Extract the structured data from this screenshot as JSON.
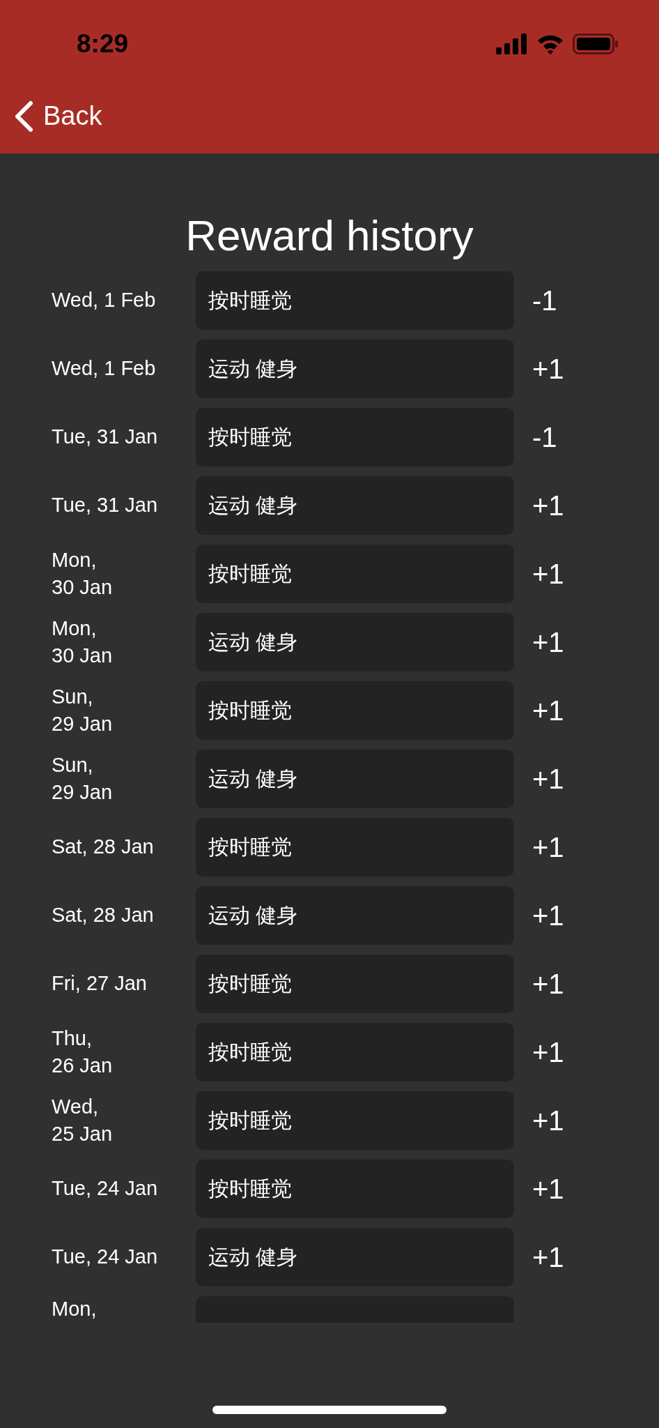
{
  "status_bar": {
    "time": "8:29"
  },
  "nav": {
    "back_label": "Back"
  },
  "title": "Reward history",
  "rows": [
    {
      "date": "Wed, 1 Feb",
      "task": "按时睡觉",
      "points": "-1"
    },
    {
      "date": "Wed, 1 Feb",
      "task": "运动 健身",
      "points": "+1"
    },
    {
      "date": "Tue, 31 Jan",
      "task": "按时睡觉",
      "points": "-1"
    },
    {
      "date": "Tue, 31 Jan",
      "task": "运动 健身",
      "points": "+1"
    },
    {
      "date": "Mon,\n30 Jan",
      "task": "按时睡觉",
      "points": "+1"
    },
    {
      "date": "Mon,\n30 Jan",
      "task": "运动 健身",
      "points": "+1"
    },
    {
      "date": "Sun,\n29 Jan",
      "task": "按时睡觉",
      "points": "+1"
    },
    {
      "date": "Sun,\n29 Jan",
      "task": "运动 健身",
      "points": "+1"
    },
    {
      "date": "Sat, 28 Jan",
      "task": "按时睡觉",
      "points": "+1"
    },
    {
      "date": "Sat, 28 Jan",
      "task": "运动 健身",
      "points": "+1"
    },
    {
      "date": "Fri, 27 Jan",
      "task": "按时睡觉",
      "points": "+1"
    },
    {
      "date": "Thu,\n26 Jan",
      "task": "按时睡觉",
      "points": "+1"
    },
    {
      "date": "Wed,\n25 Jan",
      "task": "按时睡觉",
      "points": "+1"
    },
    {
      "date": "Tue, 24 Jan",
      "task": "按时睡觉",
      "points": "+1"
    },
    {
      "date": "Tue, 24 Jan",
      "task": "运动 健身",
      "points": "+1"
    },
    {
      "date": "Mon,"
    }
  ]
}
